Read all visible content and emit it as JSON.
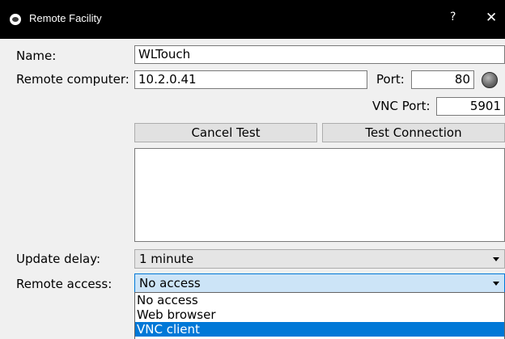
{
  "window": {
    "title": "Remote Facility",
    "help": "?",
    "close": "✕"
  },
  "form": {
    "name_label": "Name:",
    "name_value": "WLTouch",
    "remote_label": "Remote computer:",
    "remote_value": "10.2.0.41",
    "port_label": "Port:",
    "port_value": "80",
    "vnc_port_label": "VNC Port:",
    "vnc_port_value": "5901",
    "status_led_color": "#6c6c6c"
  },
  "buttons": {
    "cancel_test": "Cancel Test",
    "test_connection": "Test Connection"
  },
  "log": {
    "text": ""
  },
  "update_delay": {
    "label": "Update delay:",
    "value": "1 minute"
  },
  "remote_access": {
    "label": "Remote access:",
    "value": "No access",
    "options": [
      "No access",
      "Web browser",
      "VNC client"
    ],
    "highlighted": "VNC client"
  }
}
